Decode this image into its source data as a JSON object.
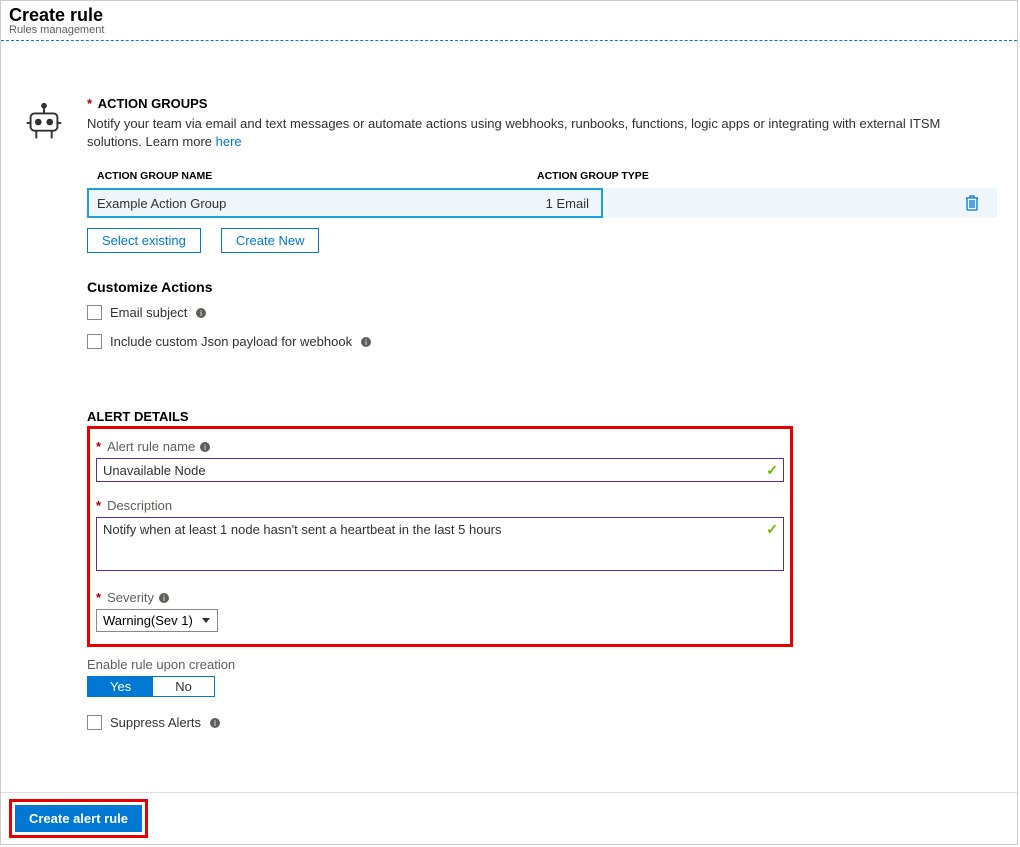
{
  "header": {
    "title": "Create rule",
    "subtitle": "Rules management"
  },
  "actionGroups": {
    "sectionTitle": "ACTION GROUPS",
    "description": "Notify your team via email and text messages or automate actions using webhooks, runbooks, functions, logic apps or integrating with external ITSM solutions. Learn more ",
    "learnMore": "here",
    "columns": {
      "name": "ACTION GROUP NAME",
      "type": "ACTION GROUP TYPE"
    },
    "rows": [
      {
        "name": "Example Action Group",
        "type": "1 Email"
      }
    ],
    "buttons": {
      "selectExisting": "Select existing",
      "createNew": "Create New"
    }
  },
  "customizeActions": {
    "title": "Customize Actions",
    "emailSubject": "Email subject",
    "customJson": "Include custom Json payload for webhook"
  },
  "alertDetails": {
    "title": "ALERT DETAILS",
    "nameLabel": "Alert rule name",
    "nameValue": "Unavailable Node",
    "descLabel": "Description",
    "descValue": "Notify when at least 1 node hasn't sent a heartbeat in the last 5 hours",
    "severityLabel": "Severity",
    "severityValue": "Warning(Sev 1)"
  },
  "enableRule": {
    "label": "Enable rule upon creation",
    "yes": "Yes",
    "no": "No"
  },
  "suppressAlerts": "Suppress Alerts",
  "footer": {
    "createButton": "Create alert rule"
  }
}
